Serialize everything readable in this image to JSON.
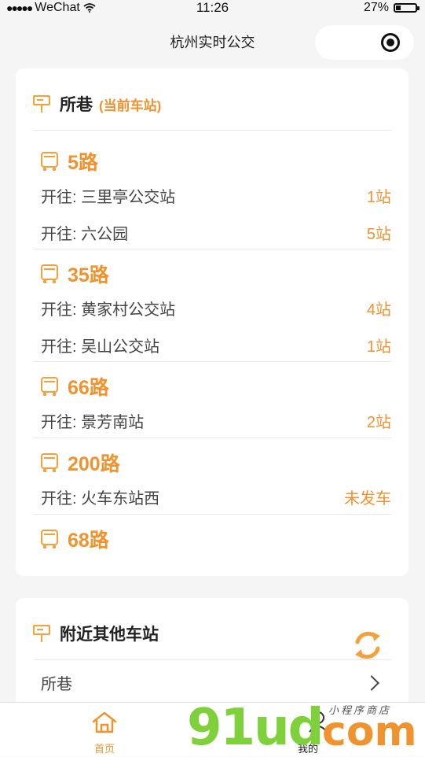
{
  "status_bar": {
    "signal_dots": "●●●●●",
    "carrier": "WeChat",
    "time": "11:26",
    "battery_percent": "27%",
    "battery_level": 0.27
  },
  "navbar": {
    "title": "杭州实时公交"
  },
  "current_station": {
    "name": "所巷",
    "tag": "(当前车站)",
    "routes": [
      {
        "name": "5路",
        "directions": [
          {
            "prefix": "开往:",
            "dest": "三里亭公交站",
            "count": "1站"
          },
          {
            "prefix": "开往:",
            "dest": "六公园",
            "count": "5站"
          }
        ]
      },
      {
        "name": "35路",
        "directions": [
          {
            "prefix": "开往:",
            "dest": "黄家村公交站",
            "count": "4站"
          },
          {
            "prefix": "开往:",
            "dest": "吴山公交站",
            "count": "1站"
          }
        ]
      },
      {
        "name": "66路",
        "directions": [
          {
            "prefix": "开往:",
            "dest": "景芳南站",
            "count": "2站"
          }
        ]
      },
      {
        "name": "200路",
        "directions": [
          {
            "prefix": "开往:",
            "dest": "火车东站西",
            "count": "未发车"
          }
        ]
      },
      {
        "name": "68路",
        "directions": []
      }
    ]
  },
  "nearby": {
    "title": "附近其他车站",
    "stations": [
      "所巷"
    ]
  },
  "tabbar": {
    "home_label": "首页",
    "mine_label": "我的"
  },
  "watermark": {
    "logo": "91ud",
    "suffix": "com",
    "small": "小程序商店"
  },
  "colors": {
    "accent": "#f0922d",
    "background": "#f5f5f5",
    "card": "#ffffff",
    "watermark_green": "#7fd13b"
  }
}
